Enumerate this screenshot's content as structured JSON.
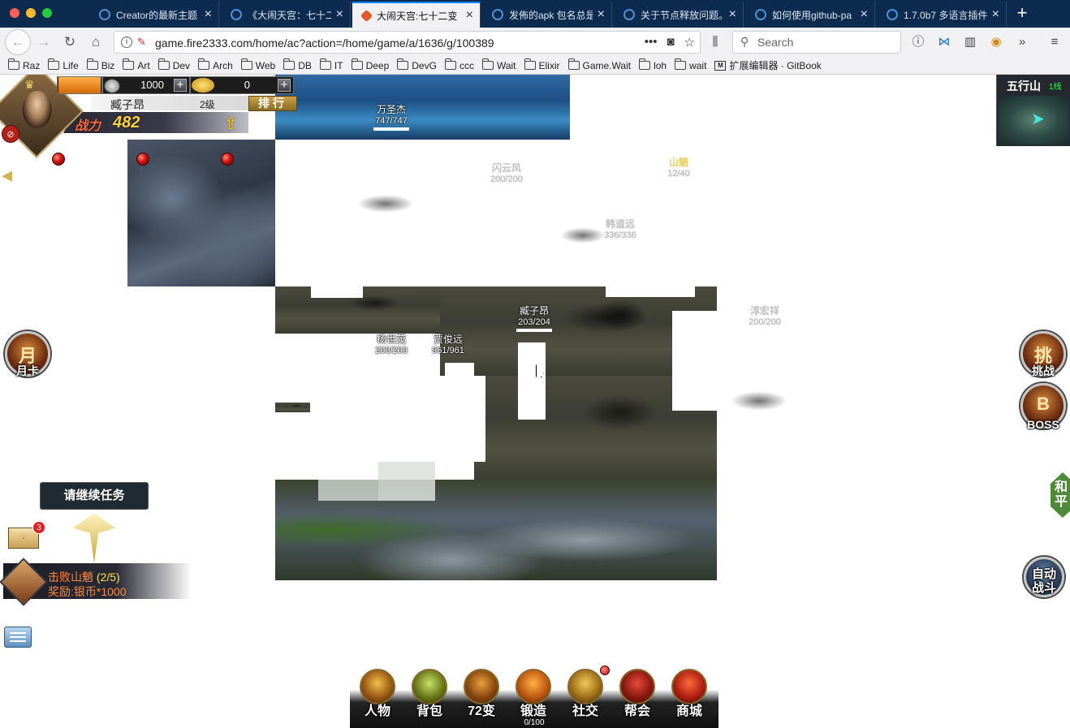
{
  "browser": {
    "tabs": [
      {
        "label": "Creator的最新主题",
        "active": false
      },
      {
        "label": "《大闹天宫：七十二",
        "active": false
      },
      {
        "label": "大闹天宫:七十二变",
        "active": true
      },
      {
        "label": "发佈的apk 包名总是",
        "active": false
      },
      {
        "label": "关于节点释放问题。",
        "active": false
      },
      {
        "label": "如何使用github-pa",
        "active": false
      },
      {
        "label": "1.7.0b7 多语言插件",
        "active": false
      }
    ],
    "url": "game.fire2333.com/home/ac?action=/home/game/a/1636/g/100389",
    "search_placeholder": "Search",
    "bookmarks": [
      "Raz",
      "Life",
      "Biz",
      "Art",
      "Dev",
      "Arch",
      "Web",
      "DB",
      "IT",
      "Deep",
      "DevG",
      "ccc",
      "Wait",
      "Elixir",
      "Game.Wait",
      "loh",
      "wait"
    ],
    "bookmark_extension": "扩展编辑器 · GitBook",
    "accent_color": "#0a84ff",
    "tabbar_color": "#0d2a4f"
  },
  "game": {
    "player": {
      "name": "臧子昂",
      "level": "2级",
      "rank_label": "排行",
      "power_label": "战力",
      "power": "482",
      "silver": "1000",
      "gold": "0",
      "vip_icon": "vip-icon"
    },
    "map": {
      "name": "五行山",
      "line": "1线"
    },
    "npcs": [
      {
        "id": "wan",
        "name": "万圣杰",
        "hp": "747/747"
      },
      {
        "id": "top-mid",
        "name": "闪云风",
        "hp": "200/200",
        "faint": true
      },
      {
        "id": "shanxiao",
        "name": "山魈",
        "hp": "12/40",
        "yellow": true
      },
      {
        "id": "mid-right",
        "name": "韩道远",
        "hp": "336/336",
        "faint": true
      },
      {
        "id": "player",
        "name": "臧子昂",
        "hp": "203/204"
      },
      {
        "id": "far-right",
        "name": "淳宏祥",
        "hp": "200/200",
        "faint": true
      },
      {
        "id": "yang",
        "name": "杨世茂",
        "hp": "200/200"
      },
      {
        "id": "jia",
        "name": "贾俊远",
        "hp": "961/961"
      }
    ],
    "side_buttons": {
      "monthly_card": {
        "glyph": "月",
        "label": "月卡"
      },
      "challenge": {
        "glyph": "挑",
        "label": "挑战"
      },
      "boss": {
        "glyph": "B",
        "label": "BOSS"
      },
      "auto_battle": {
        "label": "自动战斗"
      },
      "peace": "和平"
    },
    "continue_task": "请继续任务",
    "mail_count": "3",
    "quest": {
      "title": "击败山魈",
      "progress": "(2/5)",
      "reward": "奖励:银币*1000"
    },
    "bottom_menu": [
      {
        "label": "人物",
        "icon": "character-icon"
      },
      {
        "label": "背包",
        "icon": "bag-icon"
      },
      {
        "label": "72变",
        "icon": "transform-icon"
      },
      {
        "label": "锻造",
        "icon": "forge-icon"
      },
      {
        "label": "社交",
        "icon": "social-icon"
      },
      {
        "label": "帮会",
        "icon": "guild-icon"
      },
      {
        "label": "商城",
        "icon": "shop-icon"
      }
    ],
    "forge_counter": "0/100"
  }
}
